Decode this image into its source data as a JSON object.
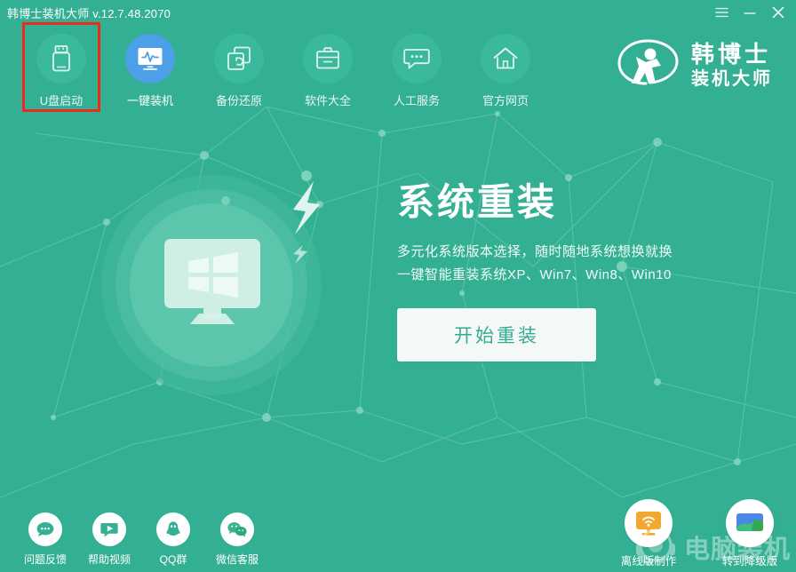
{
  "window": {
    "title": "韩博士装机大师 v.12.7.48.2070",
    "controls": [
      {
        "name": "menu",
        "icon": "hamburger-menu-icon",
        "label": "菜单"
      },
      {
        "name": "minimize",
        "icon": "minimize-icon",
        "label": "最小化"
      },
      {
        "name": "close",
        "icon": "close-icon",
        "label": "关闭"
      }
    ]
  },
  "theme": {
    "background": "#33b093",
    "toolbar_circle": "#3bb99c",
    "accent_blue": "#4d9fe8",
    "cta_background": "#f4f9f7",
    "cta_text": "#35ab91",
    "annotation_red": "#ee2b1b",
    "text_white": "#ffffff",
    "orange": "#f0a92e"
  },
  "toolbar": {
    "items": [
      {
        "label": "U盘启动",
        "icon": "usb-drive-icon",
        "active": false,
        "highlighted": true
      },
      {
        "label": "一键装机",
        "icon": "monitor-pulse-icon",
        "active": true,
        "highlighted": false
      },
      {
        "label": "备份还原",
        "icon": "copy-stack-icon",
        "active": false,
        "highlighted": false
      },
      {
        "label": "软件大全",
        "icon": "briefcase-icon",
        "active": false,
        "highlighted": false
      },
      {
        "label": "人工服务",
        "icon": "chat-bubble-icon",
        "active": false,
        "highlighted": false
      },
      {
        "label": "官方网页",
        "icon": "home-icon",
        "active": false,
        "highlighted": false
      }
    ]
  },
  "brand": {
    "logo_icon": "hanboshi-person-circle-logo",
    "line1": "韩博士",
    "line2": "装机大师"
  },
  "hero": {
    "illustration_icon": "monitor-windows-logo-illustration",
    "title": "系统重装",
    "subtitle_line1": "多元化系统版本选择，随时随地系统想换就换",
    "subtitle_line2": "一键智能重装系统XP、Win7、Win8、Win10",
    "cta_label": "开始重装"
  },
  "dock_left": {
    "items": [
      {
        "label": "问题反馈",
        "icon": "feedback-chat-icon"
      },
      {
        "label": "帮助视频",
        "icon": "video-play-icon"
      },
      {
        "label": "QQ群",
        "icon": "qq-penguin-icon"
      },
      {
        "label": "微信客服",
        "icon": "wechat-icon"
      }
    ]
  },
  "dock_right": {
    "items": [
      {
        "label": "离线版制作",
        "icon": "offline-monitor-icon"
      },
      {
        "label": "转到降级版",
        "icon": "downgrade-screen-icon"
      }
    ]
  },
  "watermark": {
    "icon": "headset-watermark-icon",
    "text": "电脑装机"
  }
}
